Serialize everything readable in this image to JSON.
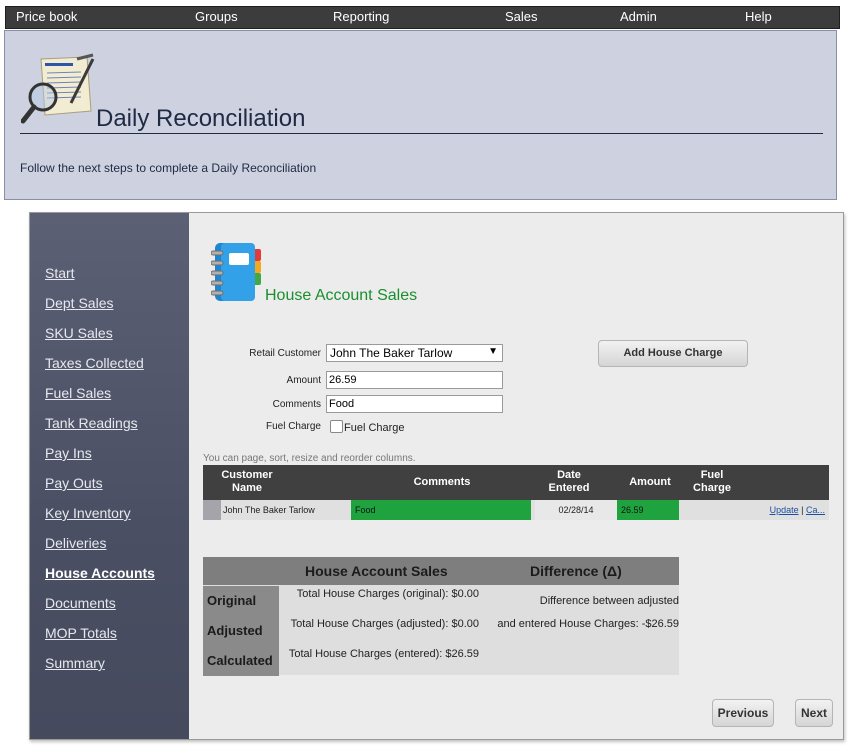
{
  "nav": {
    "items": [
      "Price book",
      "Groups",
      "Reporting",
      "Sales",
      "Admin",
      "Help"
    ]
  },
  "header": {
    "title": "Daily Reconciliation",
    "subtitle": "Follow the next steps to complete a Daily Reconciliation",
    "icon": "document-magnifier-icon"
  },
  "sidebar": {
    "items": [
      {
        "label": "Start",
        "active": false
      },
      {
        "label": "Dept Sales",
        "active": false
      },
      {
        "label": "SKU Sales",
        "active": false
      },
      {
        "label": "Taxes Collected",
        "active": false
      },
      {
        "label": "Fuel Sales",
        "active": false
      },
      {
        "label": "Tank Readings",
        "active": false
      },
      {
        "label": "Pay Ins",
        "active": false
      },
      {
        "label": "Pay Outs",
        "active": false
      },
      {
        "label": "Key Inventory",
        "active": false
      },
      {
        "label": "Deliveries",
        "active": false
      },
      {
        "label": "House Accounts",
        "active": true
      },
      {
        "label": "Documents",
        "active": false
      },
      {
        "label": "MOP Totals",
        "active": false
      },
      {
        "label": "Summary",
        "active": false
      }
    ]
  },
  "section": {
    "title": "House Account Sales",
    "icon": "notebook-icon",
    "accent_color": "#1a8f2e"
  },
  "form": {
    "retail_customer_label": "Retail Customer",
    "retail_customer_value": "John The Baker Tarlow",
    "amount_label": "Amount",
    "amount_value": "26.59",
    "comments_label": "Comments",
    "comments_value": "Food",
    "fuel_charge_label": "Fuel Charge",
    "fuel_charge_checkbox_label": "Fuel Charge",
    "add_button": "Add House Charge"
  },
  "grid": {
    "hint": "You can page, sort, resize and reorder columns.",
    "columns": [
      "Customer Name",
      "Comments",
      "Date Entered",
      "Amount",
      "Fuel Charge"
    ],
    "rows": [
      {
        "customer": "John The Baker Tarlow",
        "comments": "Food",
        "date": "02/28/14",
        "amount": "26.59",
        "fuel_charge": "",
        "update": "Update",
        "separator": "|",
        "cancel": "Ca..."
      }
    ],
    "highlight_color": "#1fa33f"
  },
  "summary": {
    "col1": "House Account Sales",
    "col2": "Difference (Δ)",
    "rows": [
      {
        "label": "Original",
        "a": "Total House Charges (original): $0.00",
        "b": "Difference between adjusted"
      },
      {
        "label": "Adjusted",
        "a": "Total House Charges (adjusted): $0.00",
        "b": "and entered House Charges: -$26.59"
      },
      {
        "label": "Calculated",
        "a": "Total House Charges (entered): $26.59",
        "b": ""
      }
    ]
  },
  "footer": {
    "previous": "Previous",
    "next": "Next"
  }
}
